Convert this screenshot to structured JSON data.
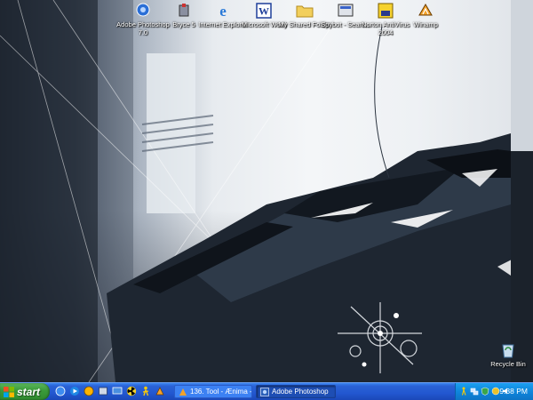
{
  "desktop_icons": [
    {
      "label": "Adobe Photoshop 7.0",
      "icon": "photoshop-icon"
    },
    {
      "label": "Bryce 5",
      "icon": "bryce-icon"
    },
    {
      "label": "Internet Explorer",
      "icon": "internet-explorer-icon"
    },
    {
      "label": "Microsoft Word",
      "icon": "word-icon"
    },
    {
      "label": "My Shared Folder",
      "icon": "folder-icon"
    },
    {
      "label": "Spybot - Searc...",
      "icon": "spybot-icon"
    },
    {
      "label": "Norton AntiVirus 2004",
      "icon": "norton-icon"
    },
    {
      "label": "Winamp",
      "icon": "winamp-icon"
    },
    {
      "label": "Recycle Bin",
      "icon": "recycle-bin-icon"
    }
  ],
  "taskbar": {
    "start_label": "start",
    "tasks": [
      {
        "label": "136. Tool - Ænima - ...",
        "icon": "winamp-icon"
      },
      {
        "label": "Adobe Photoshop",
        "icon": "photoshop-icon"
      }
    ],
    "clock": "9:38 PM"
  },
  "colors": {
    "taskbar": "#2257d0",
    "start_button": "#3a9a3a",
    "tray": "#0f86dc"
  }
}
